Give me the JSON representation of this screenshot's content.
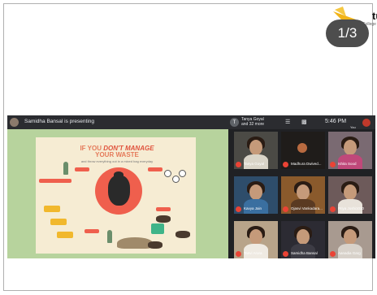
{
  "page_counter": "1/3",
  "brand": {
    "text": "tus",
    "subtext": "College"
  },
  "meet": {
    "presenter_text": "Samidha Bansal is presenting",
    "people_line1": "Tanya Goyal",
    "people_line2": "and 32 more",
    "time": "5:46 PM",
    "self_label": "You"
  },
  "slide": {
    "title_prefix": "IF YOU ",
    "title_emphasis": "DON'T MANAGE",
    "title_line2": "YOUR WASTE",
    "subtitle": "and throw everything out in a mixed bag everyday"
  },
  "participants": [
    {
      "name": "Tanya Goyal"
    },
    {
      "name": "Madhura Dwived..."
    },
    {
      "name": "Ishita Sood"
    },
    {
      "name": "Kavya Jain"
    },
    {
      "name": "Ojasvi Vankadara..."
    },
    {
      "name": "Priya Joshi1010"
    },
    {
      "name": "Tanvi Arora"
    },
    {
      "name": "Samidha Bansal"
    },
    {
      "name": "Aanadia Garg"
    }
  ],
  "colors": {
    "meet_bg": "#202124",
    "slide_bg": "#b7d39d",
    "poster_bg": "#f6ecd3",
    "accent_red": "#ef5f4d",
    "mic_muted": "#ea4335"
  },
  "icons": [
    "people-icon",
    "chat-icon",
    "activities-icon",
    "mic-off-icon"
  ]
}
